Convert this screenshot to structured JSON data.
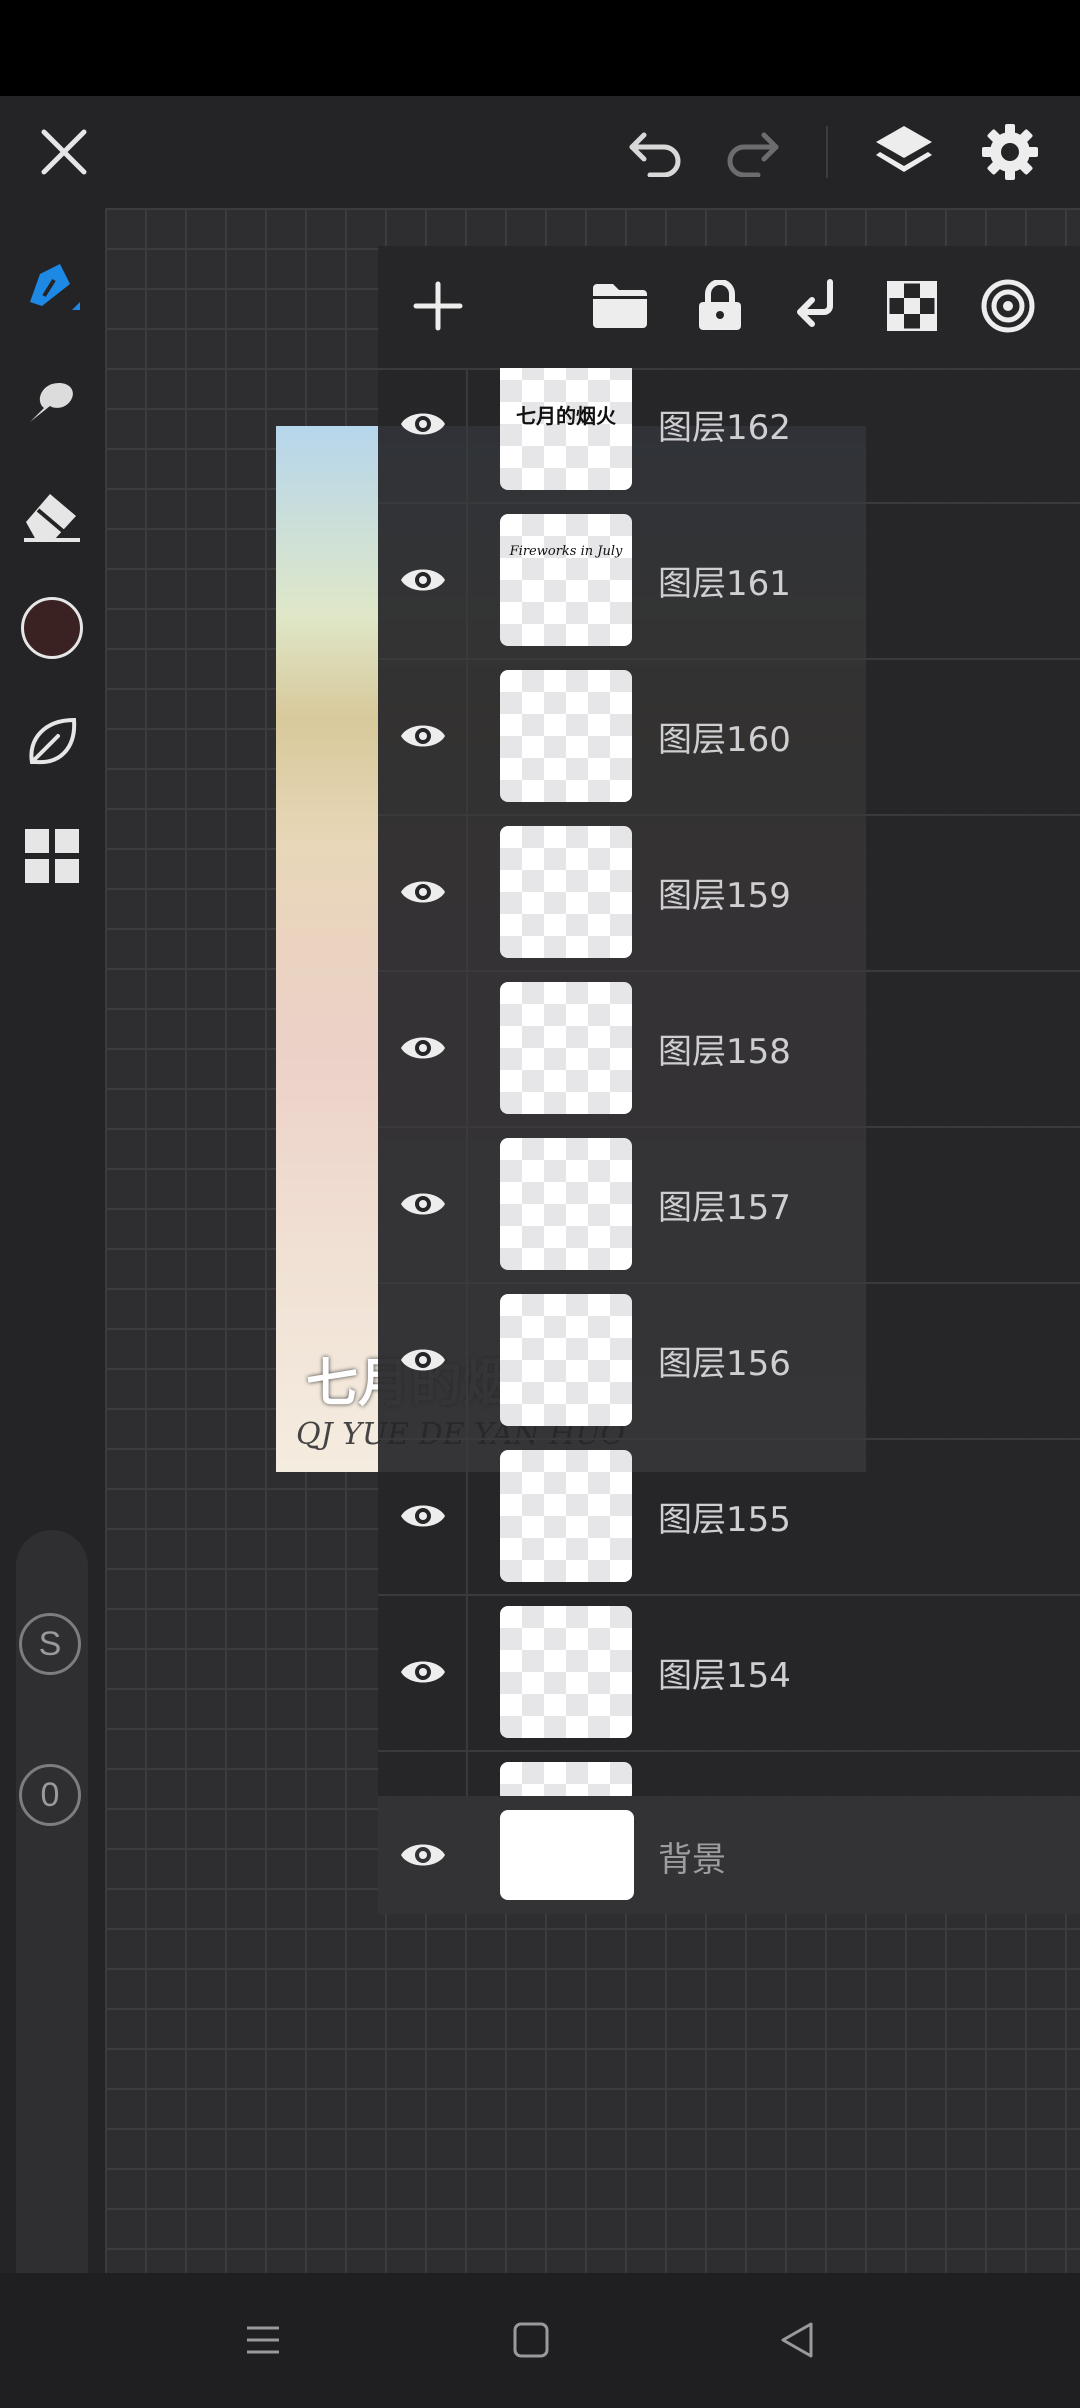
{
  "colors": {
    "accent": "#1e88e5",
    "current_color": "#3a2222"
  },
  "top_bar": {
    "icons": [
      "close-icon",
      "undo-icon",
      "redo-icon",
      "layers-icon",
      "settings-icon"
    ]
  },
  "left_toolbar": {
    "tools": [
      "brush-icon",
      "smudge-icon",
      "eraser-icon",
      "color-swatch",
      "leaf-icon",
      "grid-icon"
    ],
    "size_badge": "S",
    "opacity_badge": "0"
  },
  "artwork": {
    "title": "七月的烟火",
    "subtitle": "QJ YUE DE YAN HUO"
  },
  "layers_panel": {
    "toolbar_icons": [
      "add-layer-icon",
      "folder-icon",
      "lock-icon",
      "merge-down-icon",
      "transparency-icon",
      "layer-effects-icon"
    ],
    "layers": [
      {
        "name": "图层162",
        "thumb_text": "七月的烟火"
      },
      {
        "name": "图层161",
        "thumb_text": "Fireworks in July"
      },
      {
        "name": "图层160",
        "thumb_text": ""
      },
      {
        "name": "图层159",
        "thumb_text": ""
      },
      {
        "name": "图层158",
        "thumb_text": ""
      },
      {
        "name": "图层157",
        "thumb_text": ""
      },
      {
        "name": "图层156",
        "thumb_text": ""
      },
      {
        "name": "图层155",
        "thumb_text": ""
      },
      {
        "name": "图层154",
        "thumb_text": ""
      }
    ],
    "background_layer": {
      "name": "背景"
    }
  },
  "nav_bar": {
    "icons": [
      "menu-icon",
      "home-icon",
      "back-icon"
    ]
  }
}
